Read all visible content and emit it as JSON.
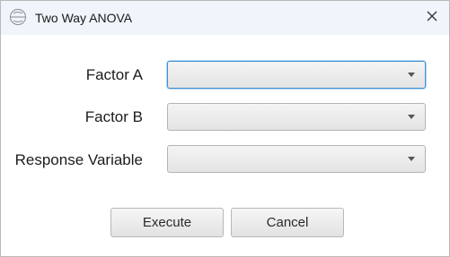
{
  "window": {
    "title": "Two Way ANOVA",
    "icon": "app-logo-icon",
    "close_icon": "close-icon"
  },
  "form": {
    "fields": [
      {
        "label": "Factor A",
        "value": ""
      },
      {
        "label": "Factor B",
        "value": ""
      },
      {
        "label": "Response Variable",
        "value": ""
      }
    ]
  },
  "buttons": {
    "execute_label": "Execute",
    "cancel_label": "Cancel"
  },
  "colors": {
    "titlebar_bg": "#f0f5fb",
    "focus_border": "#3f8fd2"
  }
}
